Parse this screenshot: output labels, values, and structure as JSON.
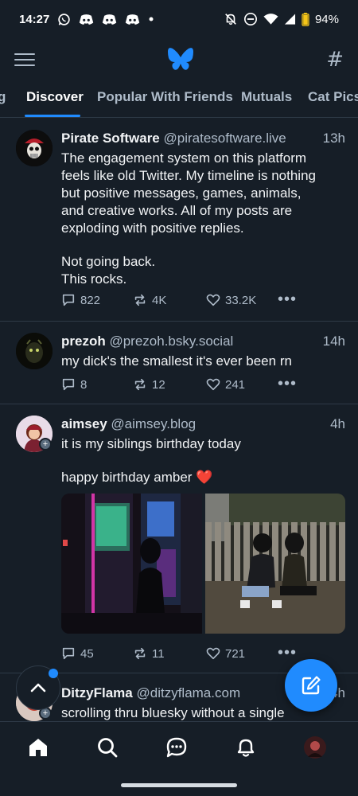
{
  "status_bar": {
    "time": "14:27",
    "battery": "94%",
    "notification_icons": [
      "whatsapp-icon",
      "discord-icon",
      "discord-icon",
      "discord-icon",
      "dot-icon"
    ],
    "system_icons": [
      "mute-icon",
      "dnd-icon",
      "wifi-icon",
      "signal-icon",
      "battery-icon"
    ]
  },
  "app_bar": {
    "menu_icon": "hamburger-icon",
    "logo_icon": "butterfly-logo-icon",
    "feeds_icon": "hash-icon"
  },
  "tabs": {
    "items": [
      {
        "label": "g"
      },
      {
        "label": "Discover"
      },
      {
        "label": "Popular With Friends"
      },
      {
        "label": "Mutuals"
      },
      {
        "label": "Cat Pics"
      }
    ],
    "active": "Discover"
  },
  "posts": [
    {
      "name": "Pirate Software",
      "handle": "@piratesoftware.live",
      "time": "13h",
      "text_lines": [
        "The engagement system on this platform",
        "feels like old Twitter. My timeline is nothing",
        "but positive messages, games, animals,",
        "and creative works. All of my posts are",
        "exploding with positive replies.",
        "",
        "Not going back.",
        "This rocks."
      ],
      "replies": "822",
      "reposts": "4K",
      "likes": "33.2K"
    },
    {
      "name": "prezoh",
      "handle": "@prezoh.bsky.social",
      "time": "14h",
      "text_lines": [
        "my dick's the smallest it's ever been rn"
      ],
      "replies": "8",
      "reposts": "12",
      "likes": "241"
    },
    {
      "name": "aimsey",
      "handle": "@aimsey.blog",
      "time": "4h",
      "text_lines": [
        "it is my siblings birthday today",
        "",
        "happy birthday amber ❤️"
      ],
      "replies": "45",
      "reposts": "11",
      "likes": "721"
    },
    {
      "name": "DitzyFlama",
      "handle": "@ditzyflama.com",
      "time": "4h",
      "text_lines": [
        "scrolling thru bluesky without a single"
      ]
    }
  ],
  "colors": {
    "background": "#161e27",
    "accent": "#208bfe",
    "muted": "#aebbc9",
    "divider": "#2e3a47"
  },
  "bottom_nav": [
    "home-icon",
    "search-icon",
    "chat-icon",
    "bell-icon",
    "profile-avatar"
  ]
}
